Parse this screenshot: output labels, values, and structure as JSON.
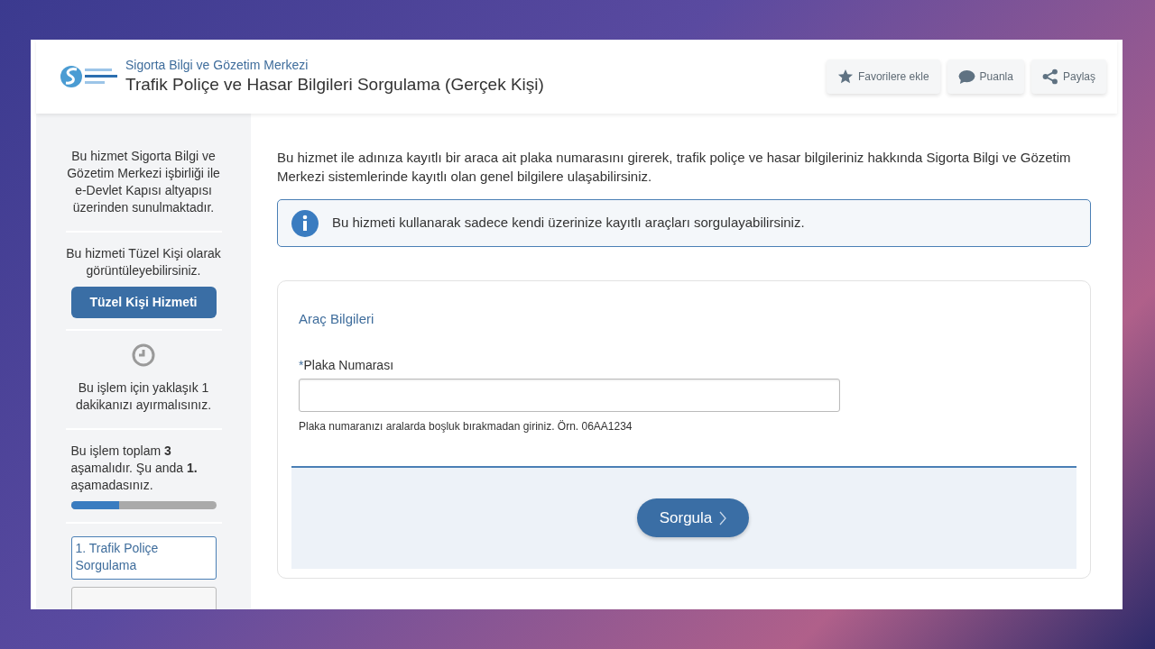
{
  "header": {
    "organization": "Sigorta Bilgi ve Gözetim Merkezi",
    "title": "Trafik Poliçe ve Hasar Bilgileri Sorgulama (Gerçek Kişi)",
    "actions": [
      {
        "kind": "favorite",
        "label": "Favorilere ekle"
      },
      {
        "kind": "rate",
        "label": "Puanla"
      },
      {
        "kind": "share",
        "label": "Paylaş"
      }
    ]
  },
  "sidebar": {
    "provider_note": "Bu hizmet Sigorta Bilgi ve Gözetim Merkezi işbirliği ile e-Devlet Kapısı altyapısı üzerinden sunulmaktadır.",
    "switch_note": "Bu hizmeti Tüzel Kişi olarak görüntüleyebilirsiniz.",
    "switch_button": "Tüzel Kişi Hizmeti",
    "duration_note": "Bu işlem için yaklaşık 1 dakikanızı ayırmalısınız.",
    "progress_note": "Bu işlem toplam **3** aşamalıdır. Şu anda **1.** aşamadasınız.",
    "progress": {
      "level": 0.333
    },
    "steps": [
      {
        "label": "1. Trafik Poliçe Sorgulama",
        "selected": true
      },
      {
        "selected": false
      }
    ]
  },
  "main": {
    "description": "Bu hizmet ile adınıza kayıtlı bir araca ait plaka numarasını girerek, trafik poliçe ve hasar bilgileriniz hakkında Sigorta Bilgi ve Gözetim Merkezi sistemlerinde kayıtlı olan genel bilgilere ulaşabilirsiniz.",
    "info": "Bu hizmeti kullanarak sadece kendi üzerinize kayıtlı araçları sorgulayabilirsiniz.",
    "form": {
      "section_title": "Araç Bilgileri",
      "required_mark": "*",
      "field_label": "Plaka Numarası",
      "help": "Plaka numaranızı aralarda boşluk bırakmadan giriniz. Örn. 06AA1234",
      "submit": "Sorgula"
    }
  }
}
